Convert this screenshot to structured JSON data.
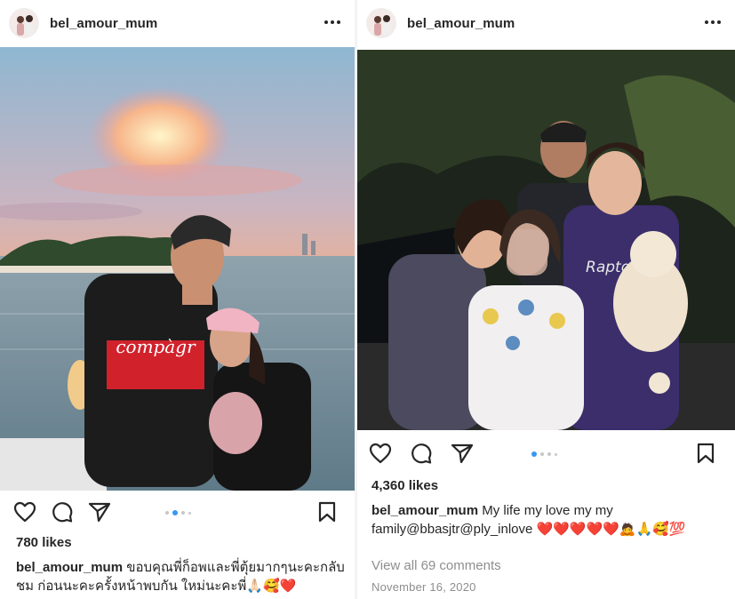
{
  "colors": {
    "accent": "#3897f0",
    "text": "#262626",
    "muted": "#8e8e8e",
    "heart": "#ed4956"
  },
  "posts": [
    {
      "username": "bel_amour_mum",
      "likes": "780 likes",
      "caption_user": "bel_amour_mum",
      "caption_text": "ขอบคุณพี่ก็อพและพี่ตุ้ยมากๆนะคะกลับชม ก่อนนะคะครั้งหน้าพบกัน ใหม่นะคะพี่🙏🏻🥰❤️",
      "shirt_text": "compàgr",
      "carousel": {
        "count": 4,
        "active": 2
      },
      "icons": [
        "heart-icon",
        "comment-icon",
        "share-icon",
        "bookmark-icon",
        "more-icon"
      ]
    },
    {
      "username": "bel_amour_mum",
      "likes": "4,360 likes",
      "caption_user": "bel_amour_mum",
      "caption_text": "My life my love my my family@bbasjtr@ply_inlove ❤️❤️❤️❤️❤️🙇🙏🥰💯",
      "jersey_text": "Raptors",
      "view_comments": "View all 69 comments",
      "date": "November 16, 2020",
      "carousel": {
        "count": 4,
        "active": 1
      },
      "icons": [
        "heart-icon",
        "comment-icon",
        "share-icon",
        "bookmark-icon",
        "more-icon"
      ]
    }
  ]
}
